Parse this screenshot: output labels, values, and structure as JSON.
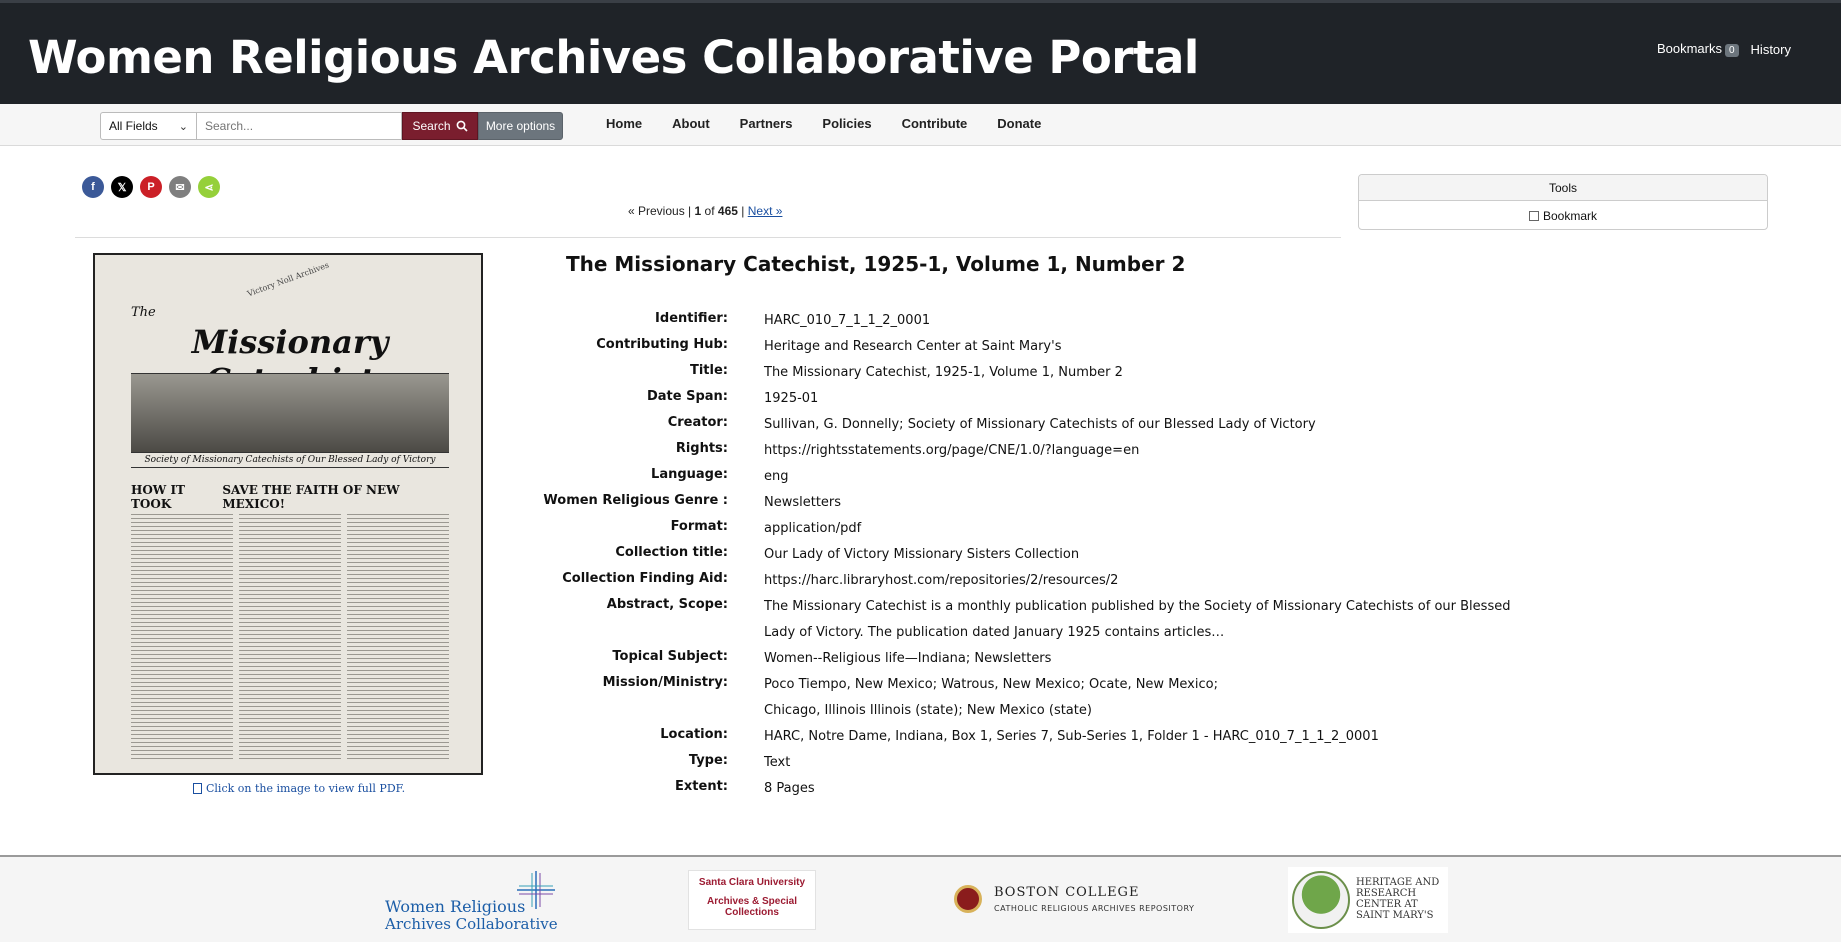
{
  "header": {
    "site_title": "Women Religious Archives Collaborative Portal",
    "bookmarks_label": "Bookmarks",
    "bookmarks_count": "0",
    "history_label": "History"
  },
  "search": {
    "field_selected": "All Fields",
    "placeholder": "Search...",
    "search_button": "Search",
    "more_options_button": "More options"
  },
  "nav": {
    "items": [
      "Home",
      "About",
      "Partners",
      "Policies",
      "Contribute",
      "Donate"
    ]
  },
  "share": {
    "icons": [
      "facebook-icon",
      "x-icon",
      "pinterest-icon",
      "email-icon",
      "share-icon"
    ],
    "colors": [
      "#3b5998",
      "#000000",
      "#cb2027",
      "#7f7f7f",
      "#95d03a"
    ]
  },
  "pager": {
    "previous": "« Previous",
    "separator": "|",
    "current": "1",
    "of_label": "of",
    "total": "465",
    "next": "Next »"
  },
  "tools": {
    "heading": "Tools",
    "bookmark_label": "Bookmark"
  },
  "thumbnail": {
    "watermark": "Victory Noll Archives",
    "masthead_small": "The",
    "masthead_big": "Missionary Catechist",
    "society_line": "Society of Missionary Catechists of Our Blessed Lady of Victory",
    "headline_left": "HOW IT TOOK",
    "headline_right": "SAVE THE FAITH OF NEW MEXICO!",
    "caption": "Click on the image to view full PDF."
  },
  "record": {
    "title": "The Missionary Catechist, 1925-1, Volume 1, Number 2",
    "fields": [
      {
        "label": "Identifier:",
        "value": "HARC_010_7_1_1_2_0001"
      },
      {
        "label": "Contributing Hub:",
        "value": "Heritage and Research Center at Saint Mary's"
      },
      {
        "label": "Title:",
        "value": "The Missionary Catechist, 1925-1, Volume 1, Number 2"
      },
      {
        "label": "Date Span:",
        "value": "1925-01"
      },
      {
        "label": "Creator:",
        "value": "Sullivan, G. Donnelly; Society of Missionary Catechists of our Blessed Lady of Victory"
      },
      {
        "label": "Rights:",
        "value": "https://rightsstatements.org/page/CNE/1.0/?language=en"
      },
      {
        "label": "Language:",
        "value": "eng"
      },
      {
        "label": "Women Religious Genre :",
        "value": "Newsletters"
      },
      {
        "label": "Format:",
        "value": "application/pdf"
      },
      {
        "label": "Collection title:",
        "value": "Our Lady of Victory Missionary Sisters Collection"
      },
      {
        "label": "Collection Finding Aid:",
        "value": "https://harc.libraryhost.com/repositories/2/resources/2"
      },
      {
        "label": "Abstract, Scope:",
        "value": "The Missionary Catechist is a monthly publication published by the Society of Missionary Catechists of our Blessed Lady of Victory. The publication dated January 1925 contains articles…"
      },
      {
        "label": "Topical Subject:",
        "value": "Women--Religious life—Indiana; Newsletters"
      },
      {
        "label": "Mission/Ministry:",
        "value": "Poco Tiempo, New Mexico; Watrous, New Mexico; Ocate, New Mexico; Chicago, Illinois Illinois (state); New Mexico (state)"
      },
      {
        "label": "Location:",
        "value": "HARC, Notre Dame, Indiana, Box 1, Series 7, Sub-Series 1, Folder 1 - HARC_010_7_1_1_2_0001"
      },
      {
        "label": "Type:",
        "value": "Text"
      },
      {
        "label": "Extent:",
        "value": "8 Pages"
      }
    ]
  },
  "footer": {
    "wrc_line1": "Women Religious",
    "wrc_line2": "Archives Collaborative",
    "scu_line1": "Santa Clara University",
    "scu_line2": "Archives & Special Collections",
    "bc_line1": "BOSTON COLLEGE",
    "bc_line2": "CATHOLIC RELIGIOUS ARCHIVES REPOSITORY",
    "hrc_line": "HERITAGE AND RESEARCH CENTER AT SAINT MARY'S"
  }
}
